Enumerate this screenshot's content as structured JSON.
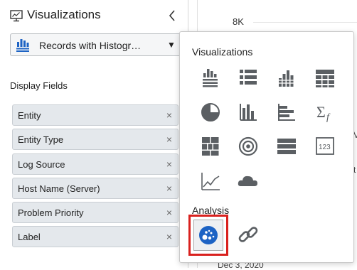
{
  "panel": {
    "title": "Visualizations",
    "icon": "monitor-chart-icon",
    "collapse_icon": "chevron-left-icon"
  },
  "viz_selector": {
    "selected": "Records with Histogr…",
    "icon": "records-histogram-icon",
    "caret": "▼"
  },
  "display_fields": {
    "label": "Display Fields",
    "remove_glyph": "×",
    "items": [
      {
        "label": "Entity"
      },
      {
        "label": "Entity Type"
      },
      {
        "label": "Log Source"
      },
      {
        "label": "Host Name (Server)"
      },
      {
        "label": "Problem Priority"
      },
      {
        "label": "Label"
      }
    ]
  },
  "chart": {
    "tick_top": "8K",
    "date_fragment": "Dec 3, 2020",
    "right_edge_fragments": [
      "V",
      "t"
    ]
  },
  "popup": {
    "visualizations_heading": "Visualizations",
    "analysis_heading": "Analysis",
    "visualization_options": [
      {
        "icon": "records-histogram-icon"
      },
      {
        "icon": "records-table-icon"
      },
      {
        "icon": "histogram-icon"
      },
      {
        "icon": "table-grid-icon"
      },
      {
        "icon": "pie-chart-icon"
      },
      {
        "icon": "bar-chart-icon"
      },
      {
        "icon": "horizontal-bar-chart-icon"
      },
      {
        "icon": "summary-table-sigma-icon"
      },
      {
        "icon": "treemap-icon"
      },
      {
        "icon": "sunburst-icon"
      },
      {
        "icon": "distinct-list-icon"
      },
      {
        "icon": "tile-123-icon"
      },
      {
        "icon": "line-chart-icon"
      },
      {
        "icon": "word-cloud-icon"
      }
    ],
    "analysis_options": [
      {
        "icon": "cluster-icon",
        "selected": true
      },
      {
        "icon": "link-icon",
        "selected": false
      }
    ],
    "selected_outline_color": "#d9211e",
    "icon_color": "#5b5f63",
    "accent_color": "#1d63c4"
  }
}
